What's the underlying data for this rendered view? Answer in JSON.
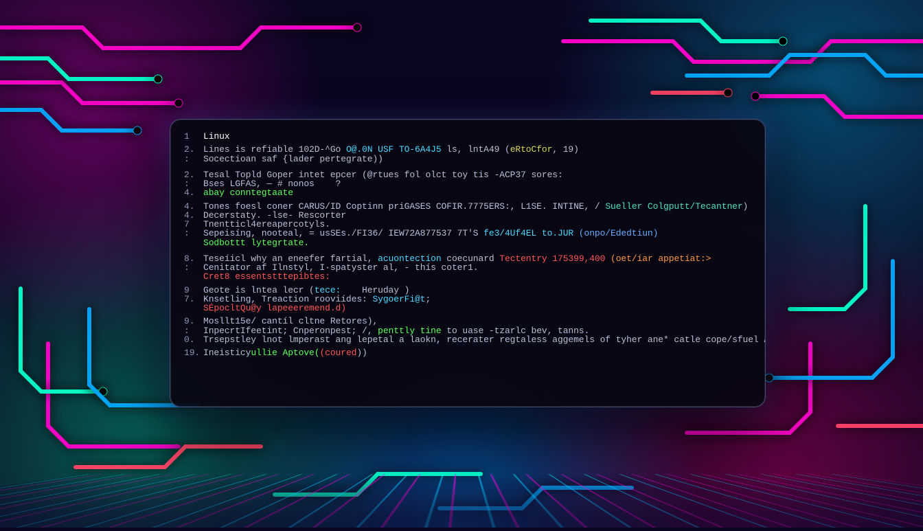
{
  "terminal": {
    "title": "Linux",
    "lines": [
      {
        "num": "1",
        "segments": [
          {
            "text": "Linux",
            "cls": "c-white"
          }
        ]
      },
      {
        "spacer": "sm"
      },
      {
        "num": "2.",
        "segments": [
          {
            "text": "Lines is refiable 102D-^Go ",
            "cls": "c-dim"
          },
          {
            "text": "O@.0N USF TO-6A4J5",
            "cls": "c-cyan"
          },
          {
            "text": " ls, lntA49 (",
            "cls": "c-dim"
          },
          {
            "text": "eRtoCfor",
            "cls": "c-yellow"
          },
          {
            "text": ", 19)",
            "cls": "c-dim"
          }
        ]
      },
      {
        "num": ":",
        "segments": [
          {
            "text": "Socectioan saf {lader pertegrate))",
            "cls": "c-dim"
          }
        ]
      },
      {
        "spacer": true
      },
      {
        "num": "2.",
        "segments": [
          {
            "text": "Tesal Topld Goper intet epcer (@rtues fol olct toy tis -ACP37 sores:",
            "cls": "c-dim"
          }
        ]
      },
      {
        "num": ":",
        "segments": [
          {
            "text": "Bses LGFAS, — # nonos    ?",
            "cls": "c-dim"
          }
        ]
      },
      {
        "num": "4.",
        "segments": [
          {
            "text": "abay conntegtaate",
            "cls": "c-green"
          }
        ]
      },
      {
        "spacer": "sm"
      },
      {
        "num": "4.",
        "segments": [
          {
            "text": "Tones foesl coner CARUS/ID Coptinn priGASES COFIR.7775ERS:, L1SE. INTINE, / ",
            "cls": "c-dim"
          },
          {
            "text": "Sueller Colgputt/Tecantner",
            "cls": "c-teal"
          },
          {
            "text": ")",
            "cls": "c-dim"
          }
        ]
      },
      {
        "num": "4.",
        "segments": [
          {
            "text": "Decerstaty. -lse- Rescorter",
            "cls": "c-dim"
          }
        ]
      },
      {
        "num": "7",
        "segments": [
          {
            "text": "Tnentticl4ereapercotyls.",
            "cls": "c-dim"
          }
        ]
      },
      {
        "num": ":",
        "segments": [
          {
            "text": "Sepeisíng, nooteal, = usSEs./FI36/ IEW72A877537 7T'S ",
            "cls": "c-dim"
          },
          {
            "text": "fe3/4Uf4EL to.JUR",
            "cls": "c-cyan"
          },
          {
            "text": " (onpo/Ededtiun)",
            "cls": "c-blue"
          }
        ]
      },
      {
        "num": "",
        "segments": [
          {
            "text": "Sodbottt lytegrtate.",
            "cls": "c-green"
          }
        ]
      },
      {
        "spacer": true
      },
      {
        "num": "8.",
        "segments": [
          {
            "text": "Teseíicl why an eneefer fartial, ",
            "cls": "c-dim"
          },
          {
            "text": "acuontectíon",
            "cls": "c-cyan"
          },
          {
            "text": " coecunard ",
            "cls": "c-dim"
          },
          {
            "text": "Tectentry 175399,400",
            "cls": "c-red"
          },
          {
            "text": " (oet/íar appetíat:>",
            "cls": "c-orange"
          }
        ]
      },
      {
        "num": ":",
        "segments": [
          {
            "text": "Cenitator af Ilnstyl, I·spatyster al, - thís coter1.",
            "cls": "c-dim"
          }
        ]
      },
      {
        "num": "",
        "segments": [
          {
            "text": "Cret8 essentstttepibtes:",
            "cls": "c-red"
          }
        ]
      },
      {
        "spacer": "sm"
      },
      {
        "num": "9",
        "segments": [
          {
            "text": "Geote is lntea lecr (",
            "cls": "c-dim"
          },
          {
            "text": "tece:",
            "cls": "c-cyan"
          },
          {
            "text": "    Heruday )",
            "cls": "c-dim"
          }
        ]
      },
      {
        "num": "7.",
        "segments": [
          {
            "text": "Knsetling, Treaction rooviídes: ",
            "cls": "c-dim"
          },
          {
            "text": "SygoerFi@t",
            "cls": "c-cyan"
          },
          {
            "text": ";",
            "cls": "c-dim"
          }
        ]
      },
      {
        "num": "",
        "segments": [
          {
            "text": "SÉpocltQu@y lapeeeremend.d)",
            "cls": "c-red"
          }
        ]
      },
      {
        "spacer": "sm"
      },
      {
        "num": "9.",
        "segments": [
          {
            "text": "Mosllt15e/ cantíl cltne Retores),",
            "cls": "c-dim"
          }
        ]
      },
      {
        "num": ":",
        "segments": [
          {
            "text": "InpecrtIfeetint; Cnperonpest; /, ",
            "cls": "c-dim"
          },
          {
            "text": "penttly tine",
            "cls": "c-green"
          },
          {
            "text": " to uase -tzarlc bev, tanns.",
            "cls": "c-dim"
          }
        ]
      },
      {
        "num": "0.",
        "segments": [
          {
            "text": "Trsepstley lnot lmperast ang lepetal a laokn, recerater regtaless aggemels of tyher ane* catle cope/sfuel AST.",
            "cls": "c-dim"
          }
        ]
      },
      {
        "spacer": "sm"
      },
      {
        "num": "19.",
        "segments": [
          {
            "text": "Ineisticy",
            "cls": "c-dim"
          },
          {
            "text": "ullie Aptove(",
            "cls": "c-green"
          },
          {
            "text": "(coured",
            "cls": "c-red"
          },
          {
            "text": "))",
            "cls": "c-dim"
          }
        ]
      }
    ]
  }
}
